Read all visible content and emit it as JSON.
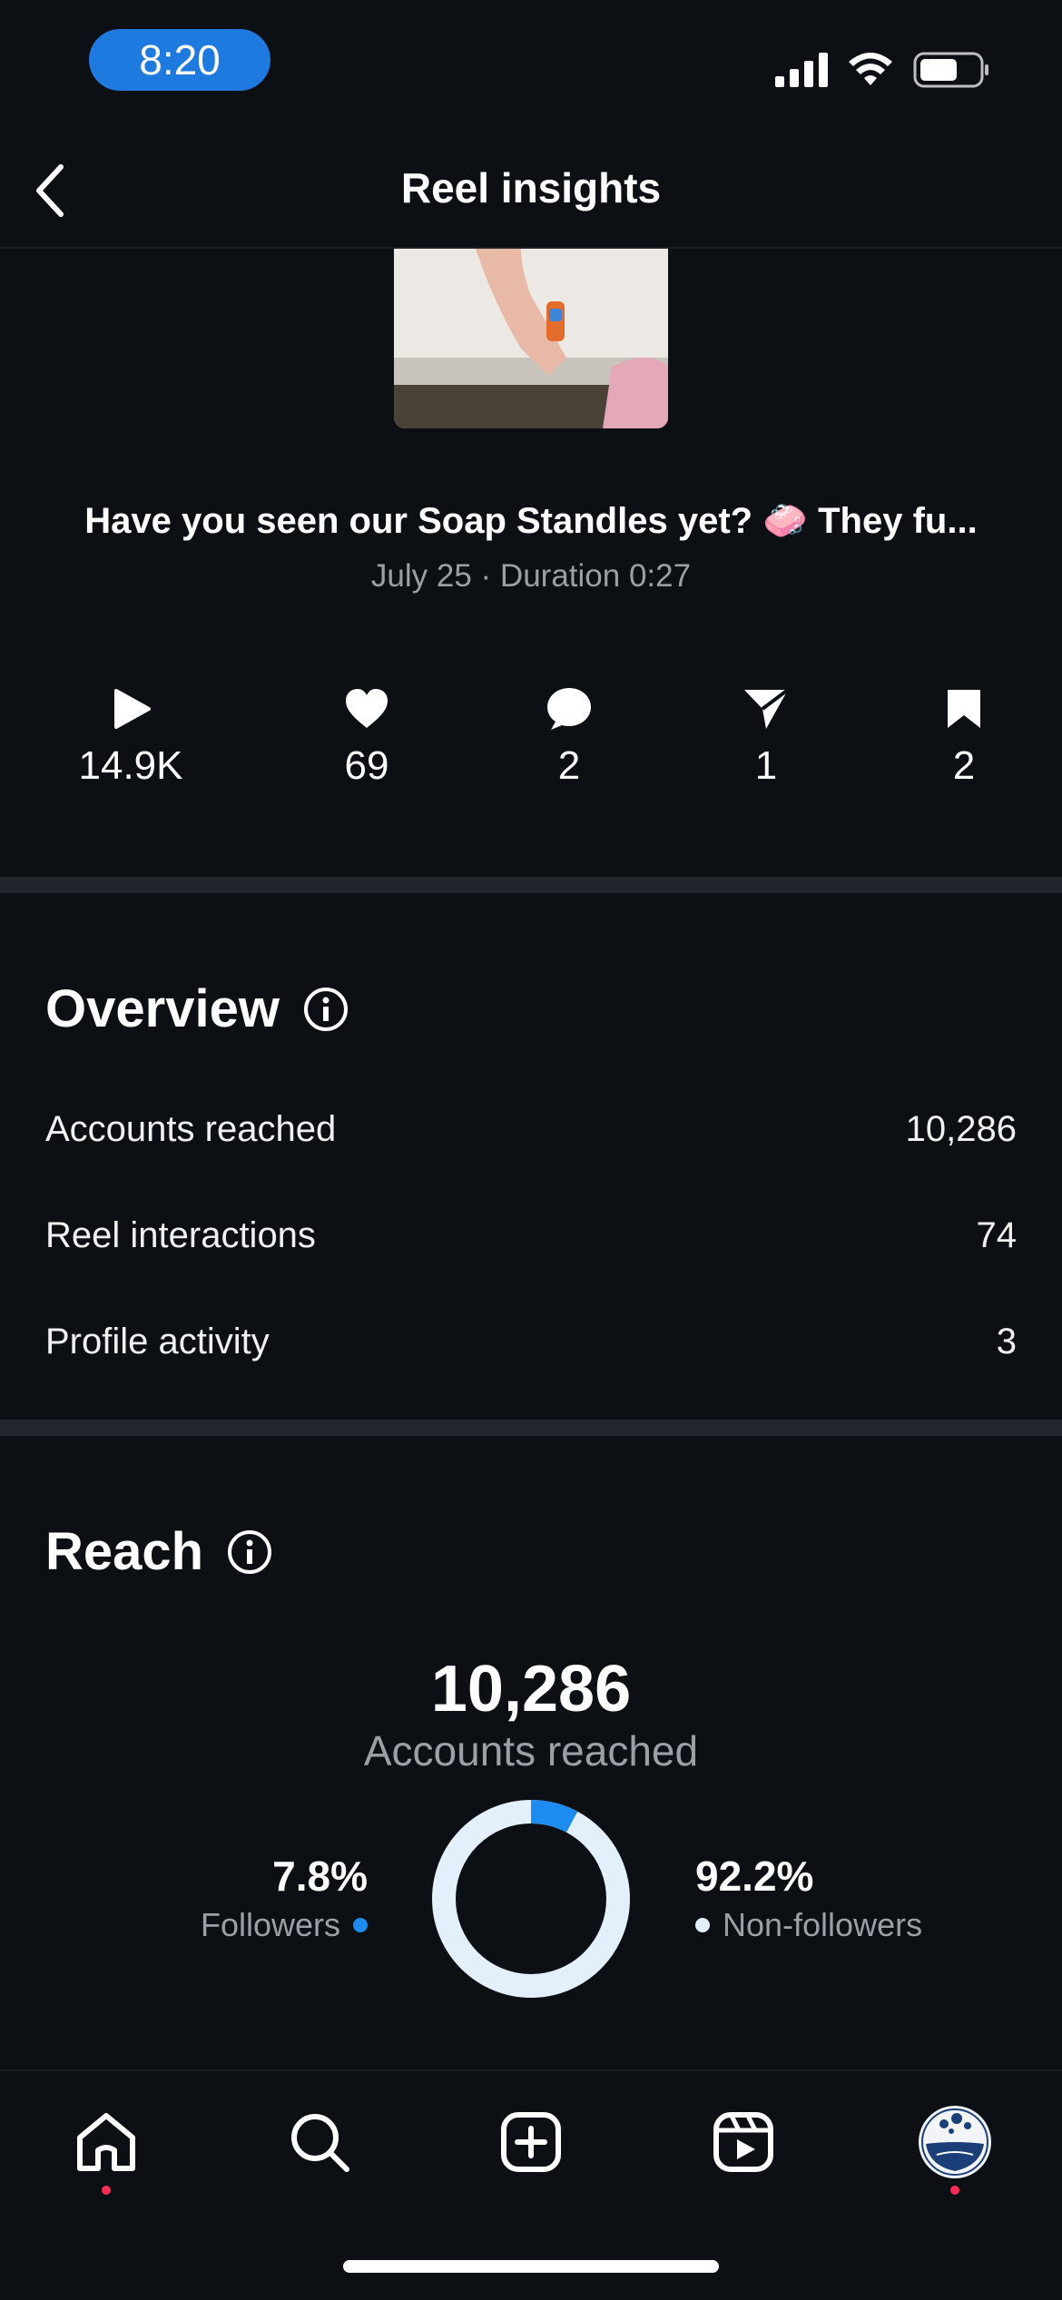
{
  "status_bar": {
    "time": "8:20"
  },
  "header": {
    "title": "Reel insights",
    "back_icon": "chevron-left-icon"
  },
  "reel": {
    "caption": "Have you seen our Soap Standles yet? 🧼 They fu...",
    "meta": "July 25 · Duration 0:27"
  },
  "stats": [
    {
      "icon": "play-icon",
      "value": "14.9K"
    },
    {
      "icon": "heart-icon",
      "value": "69"
    },
    {
      "icon": "comment-icon",
      "value": "2"
    },
    {
      "icon": "send-icon",
      "value": "1"
    },
    {
      "icon": "bookmark-icon",
      "value": "2"
    }
  ],
  "overview": {
    "title": "Overview",
    "rows": [
      {
        "label": "Accounts reached",
        "value": "10,286"
      },
      {
        "label": "Reel interactions",
        "value": "74"
      },
      {
        "label": "Profile activity",
        "value": "3"
      }
    ]
  },
  "reach": {
    "title": "Reach",
    "total": "10,286",
    "total_label": "Accounts reached",
    "followers_pct": "7.8%",
    "followers_label": "Followers",
    "non_followers_pct": "92.2%",
    "non_followers_label": "Non-followers",
    "followers_fraction": 0.078,
    "colors": {
      "followers": "#1d8cf0",
      "non_followers": "#e3f0fc"
    }
  },
  "tab_bar": {
    "items": [
      "home-icon",
      "search-icon",
      "create-icon",
      "reels-icon",
      "profile-avatar"
    ]
  },
  "colors": {
    "background": "#0c0f14",
    "separator": "#22262c",
    "accent": "#1d8cf0",
    "notification_dot": "#ff2d55"
  }
}
